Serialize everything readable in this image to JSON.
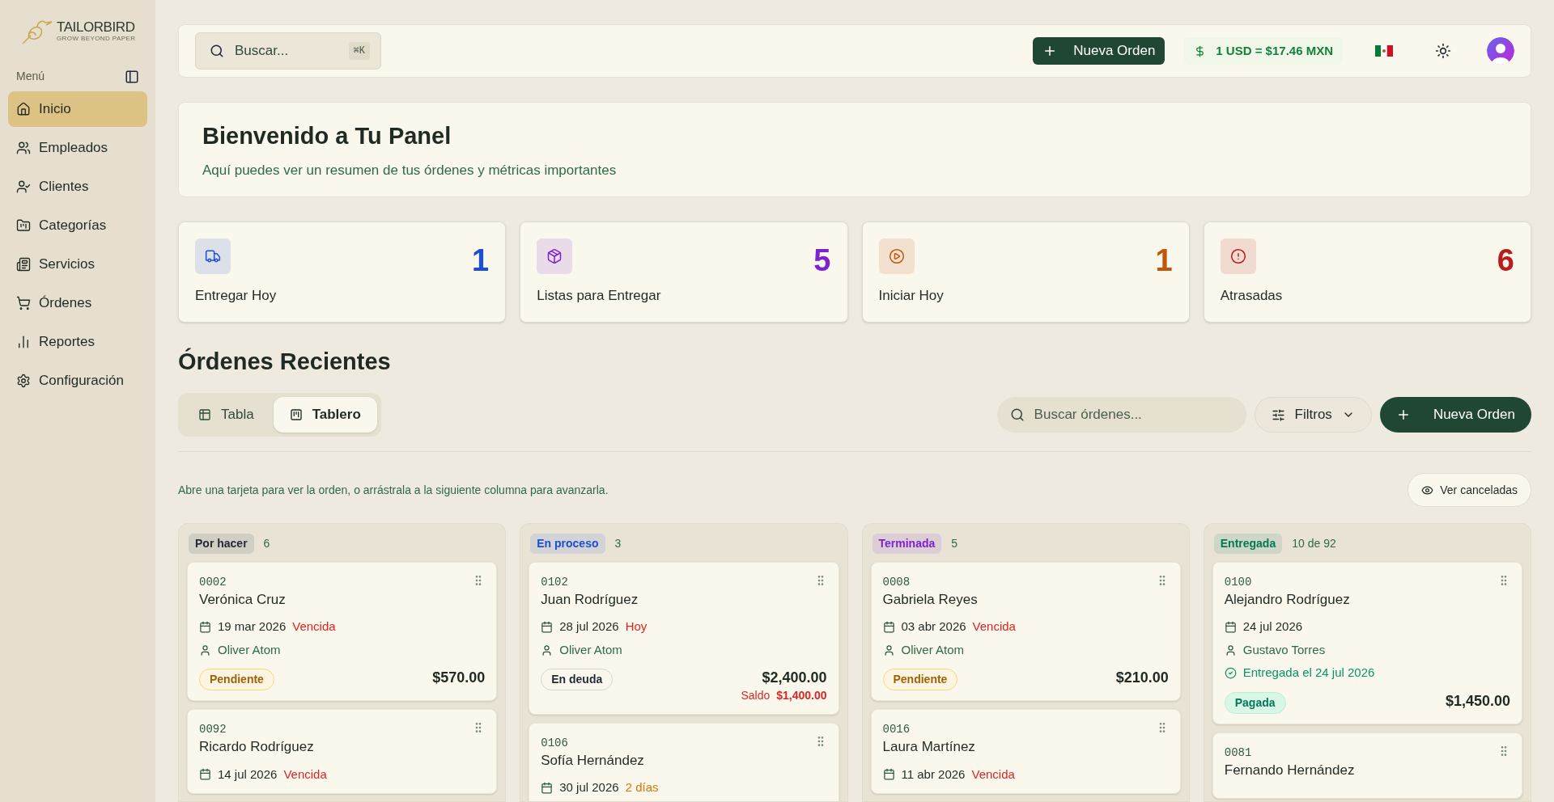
{
  "sidebar": {
    "logo": {
      "name": "TAILORBIRD",
      "tagline": "GROW BEYOND PAPER"
    },
    "menu_label": "Menú",
    "items": [
      {
        "label": "Inicio",
        "selected": true
      },
      {
        "label": "Empleados",
        "selected": false
      },
      {
        "label": "Clientes",
        "selected": false
      },
      {
        "label": "Categorías",
        "selected": false
      },
      {
        "label": "Servicios",
        "selected": false
      },
      {
        "label": "Órdenes",
        "selected": false
      },
      {
        "label": "Reportes",
        "selected": false
      },
      {
        "label": "Configuración",
        "selected": false
      }
    ]
  },
  "header": {
    "search": {
      "placeholder": "Buscar...",
      "shortcut": "⌘K"
    },
    "new_order_button": "Nueva Orden",
    "exchange_rate": "1 USD = $17.46 MXN"
  },
  "welcome": {
    "title": "Bienvenido a Tu Panel",
    "subtitle": "Aquí puedes ver un resumen de tus órdenes y métricas importantes"
  },
  "stats": [
    {
      "label": "Entregar Hoy",
      "value": "1",
      "color": "#1d4ed8"
    },
    {
      "label": "Listas para Entregar",
      "value": "5",
      "color": "#7e22ce"
    },
    {
      "label": "Iniciar Hoy",
      "value": "1",
      "color": "#c2560c"
    },
    {
      "label": "Atrasadas",
      "value": "6",
      "color": "#b91c1c"
    }
  ],
  "recent": {
    "title": "Órdenes Recientes",
    "tabs": [
      {
        "label": "Tabla",
        "selected": false
      },
      {
        "label": "Tablero",
        "selected": true
      }
    ],
    "search": {
      "placeholder": "Buscar órdenes..."
    },
    "filters_button": "Filtros",
    "new_order_button": "Nueva Orden",
    "hint": "Abre una tarjeta para ver la orden, o arrástrala a la siguiente columna para avanzarla.",
    "view_cancelled_button": "Ver canceladas"
  },
  "columns": [
    {
      "status": "Por hacer",
      "count": "6",
      "color": "#1f2937",
      "cards": [
        {
          "number": "0002",
          "name": "Verónica Cruz",
          "date": "19 mar 2026",
          "due": {
            "label": "Vencida",
            "kind": "overdue"
          },
          "assignee": "Oliver Atom",
          "payment": {
            "label": "Pendiente",
            "kind": "pending"
          },
          "total": "$570.00"
        },
        {
          "number": "0092",
          "name": "Ricardo Rodríguez",
          "date": "14 jul 2026",
          "due": {
            "label": "Vencida",
            "kind": "overdue"
          }
        }
      ]
    },
    {
      "status": "En proceso",
      "count": "3",
      "color": "#1d4ed8",
      "cards": [
        {
          "number": "0102",
          "name": "Juan Rodríguez",
          "date": "28 jul 2026",
          "due": {
            "label": "Hoy",
            "kind": "today"
          },
          "assignee": "Oliver Atom",
          "payment": {
            "label": "En deuda",
            "kind": "debt"
          },
          "total": "$2,400.00",
          "balance_label": "Saldo",
          "balance": "$1,400.00"
        },
        {
          "number": "0106",
          "name": "Sofía Hernández",
          "date": "30 jul 2026",
          "due": {
            "label": "2 días",
            "kind": "soon"
          }
        }
      ]
    },
    {
      "status": "Terminada",
      "count": "5",
      "color": "#7e22ce",
      "cards": [
        {
          "number": "0008",
          "name": "Gabriela Reyes",
          "date": "03 abr 2026",
          "due": {
            "label": "Vencida",
            "kind": "overdue"
          },
          "assignee": "Oliver Atom",
          "payment": {
            "label": "Pendiente",
            "kind": "pending"
          },
          "total": "$210.00"
        },
        {
          "number": "0016",
          "name": "Laura Martínez",
          "date": "11 abr 2026",
          "due": {
            "label": "Vencida",
            "kind": "overdue"
          }
        }
      ]
    },
    {
      "status": "Entregada",
      "count": "10 de 92",
      "color": "#047857",
      "cards": [
        {
          "number": "0100",
          "name": "Alejandro Rodríguez",
          "date": "24 jul 2026",
          "assignee": "Gustavo Torres",
          "delivered": "Entregada el 24 jul 2026",
          "payment": {
            "label": "Pagada",
            "kind": "paid"
          },
          "total": "$1,450.00"
        },
        {
          "number": "0081",
          "name": "Fernando Hernández"
        }
      ]
    }
  ]
}
